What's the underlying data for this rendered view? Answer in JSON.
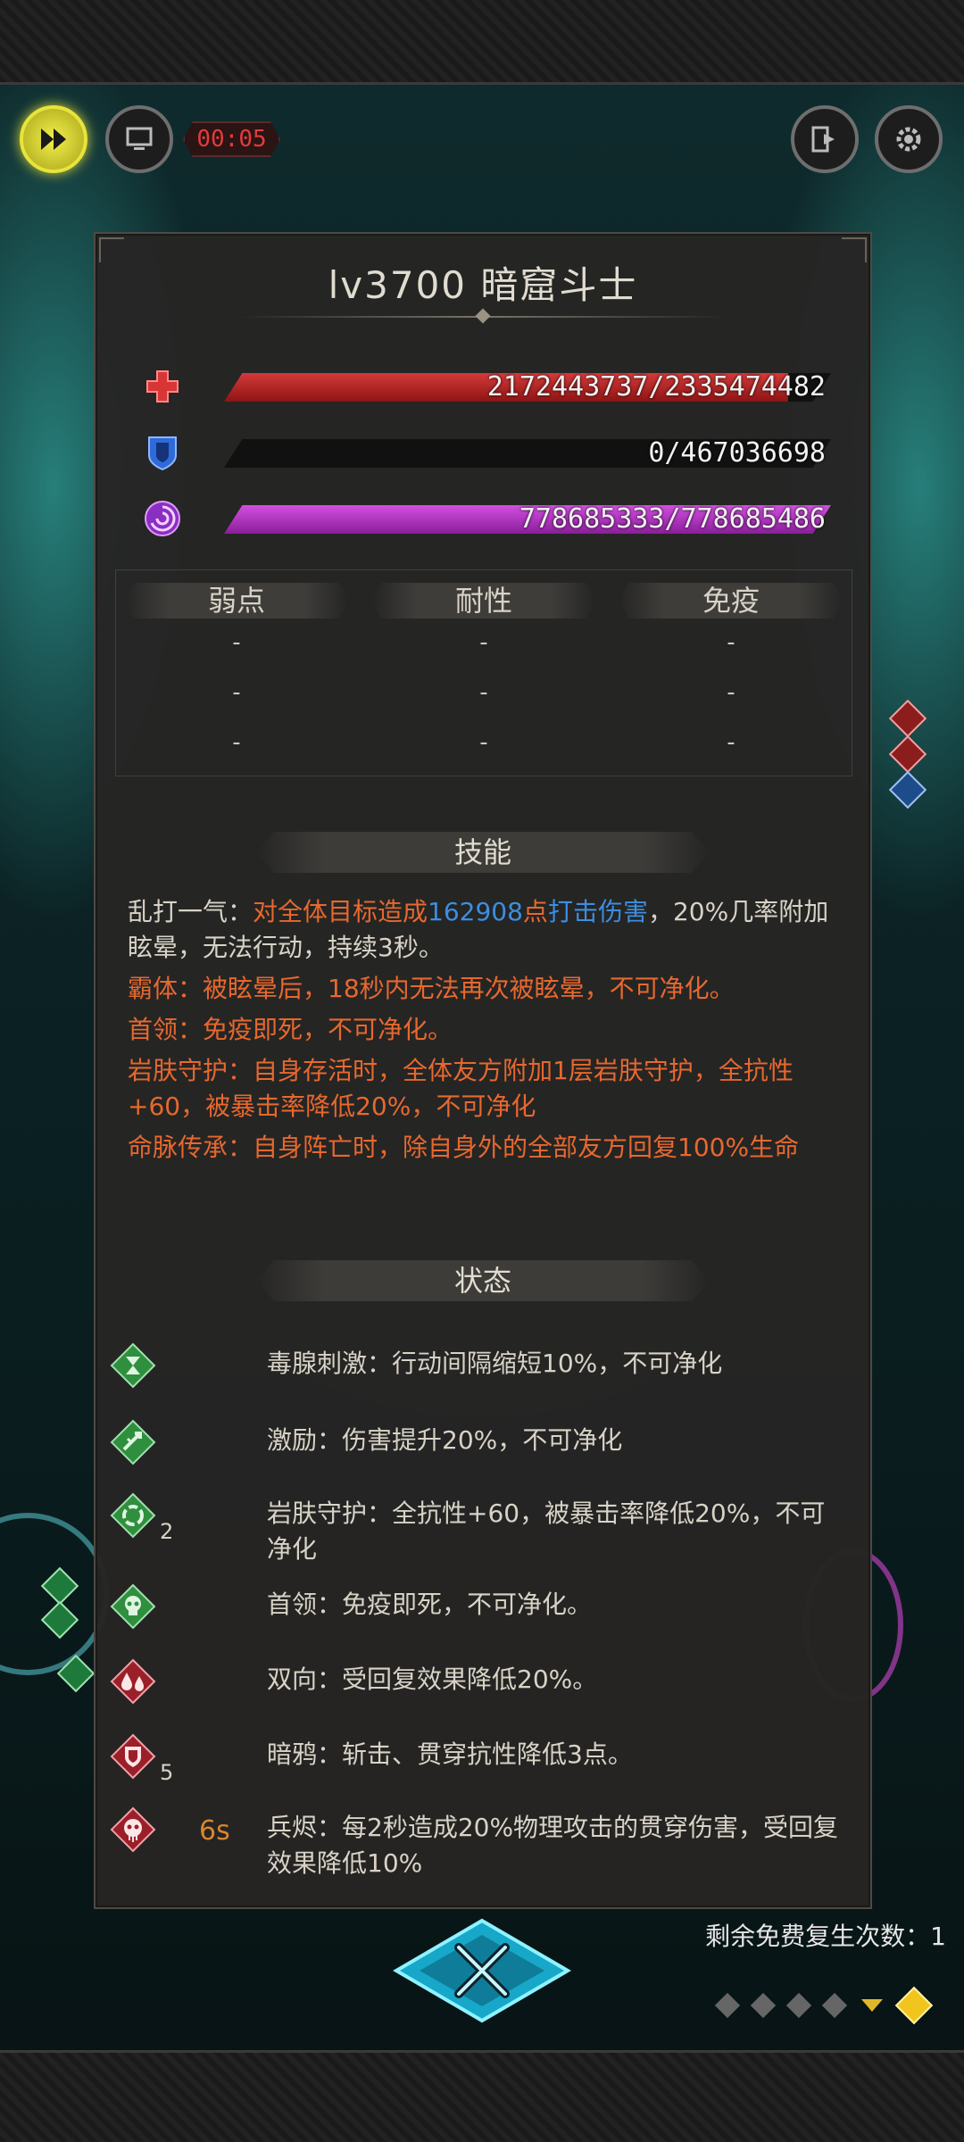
{
  "hud": {
    "timer": "00:05"
  },
  "panel": {
    "title": "lv3700 暗窟斗士",
    "hp": {
      "text": "2172443737/2335474482",
      "fill": 0.93
    },
    "shield": {
      "text": "0/467036698",
      "fill": 0
    },
    "energy": {
      "text": "778685333/778685486",
      "fill": 1.0
    },
    "resist_headers": [
      "弱点",
      "耐性",
      "免疫"
    ],
    "resist_rows": [
      [
        "-",
        "-",
        "-"
      ],
      [
        "-",
        "-",
        "-"
      ],
      [
        "-",
        "-",
        "-"
      ]
    ],
    "skills_header": "技能",
    "skills": [
      {
        "name": "乱打一气：",
        "pre": "对全体目标造成",
        "num": "162908",
        "mid": "点",
        "link": "打击伤害",
        "post": "，20%几率附加眩晕，无法行动，持续3秒。"
      },
      {
        "name": "霸体：",
        "text": "被眩晕后，18秒内无法再次被眩晕，不可净化。"
      },
      {
        "name": "首领：",
        "text": "免疫即死，不可净化。"
      },
      {
        "name": "岩肤守护：",
        "text": "自身存活时，全体友方附加1层岩肤守护，全抗性+60，被暴击率降低20%，不可净化"
      },
      {
        "name": "命脉传承：",
        "text": "自身阵亡时，除自身外的全部友方回复100%生命"
      }
    ],
    "status_header": "状态",
    "statuses": [
      {
        "icon": "hourglass-icon",
        "count": "",
        "time": "",
        "text": "毒腺刺激：行动间隔缩短10%，不可净化"
      },
      {
        "icon": "sword-up-icon",
        "count": "",
        "time": "",
        "text": "激励：伤害提升20%，不可净化"
      },
      {
        "icon": "stone-skin-icon",
        "count": "2",
        "time": "",
        "text": "岩肤守护：全抗性+60，被暴击率降低20%，不可净化"
      },
      {
        "icon": "skull-icon",
        "count": "",
        "time": "",
        "text": "首领：免疫即死，不可净化。"
      },
      {
        "icon": "double-drop-icon",
        "count": "",
        "time": "",
        "text": "双向：受回复效果降低20%。"
      },
      {
        "icon": "broken-shield-icon",
        "count": "5",
        "time": "",
        "text": "暗鸦：斩击、贯穿抗性降低3点。"
      },
      {
        "icon": "bleeding-skull-icon",
        "count": "",
        "time": "6s",
        "text": "兵烬：每2秒造成20%物理攻击的贯穿伤害，受回复效果降低10%"
      }
    ]
  },
  "footer": {
    "revive_text": "剩余免费复生次数：1"
  }
}
